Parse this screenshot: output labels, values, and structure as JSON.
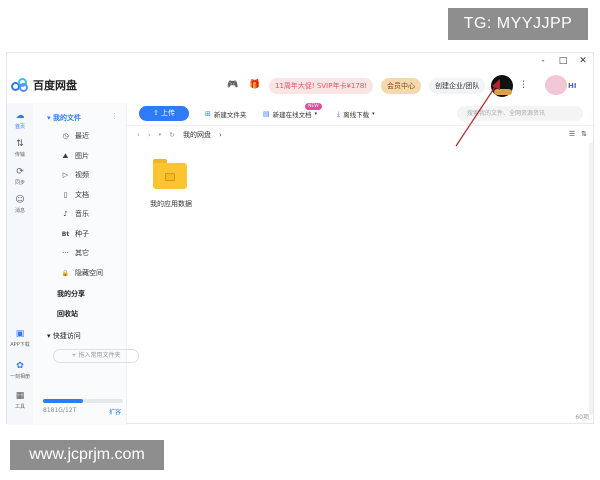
{
  "watermarks": {
    "top": "TG: MYYJJPP",
    "bottom": "www.jcprjm.com"
  },
  "window": {
    "controls": [
      "-",
      "□",
      "✕"
    ]
  },
  "app": {
    "title": "百度网盘"
  },
  "header": {
    "promo": "11周年大促! SVIP年卡¥178!",
    "vip_center": "会员中心",
    "create_business": "创建企业/团队",
    "more": "⋮",
    "mascot_greeting": "HI"
  },
  "rail": {
    "items": [
      {
        "label": "首页",
        "icon": "☁"
      },
      {
        "label": "传输",
        "icon": "⇅"
      },
      {
        "label": "同步",
        "icon": "⟳"
      },
      {
        "label": "消息",
        "icon": "☺"
      },
      {
        "label": "APP下载",
        "icon": "▣"
      },
      {
        "label": "一刻相册",
        "icon": "✿"
      },
      {
        "label": "工具",
        "icon": "▦"
      }
    ]
  },
  "sidebar": {
    "my_files": "我的文件",
    "items": [
      {
        "label": "最近",
        "icon": "◷"
      },
      {
        "label": "图片",
        "icon": "⛰"
      },
      {
        "label": "视频",
        "icon": "▷"
      },
      {
        "label": "文档",
        "icon": "▯"
      },
      {
        "label": "音乐",
        "icon": "♪"
      },
      {
        "label": "种子",
        "icon": "Bt"
      },
      {
        "label": "其它",
        "icon": "···"
      },
      {
        "label": "隐藏空间",
        "icon": "🔒"
      }
    ],
    "my_share": "我的分享",
    "recycle_bin": "回收站",
    "quick_access": "快捷访问",
    "add_quick": "+ 拖入常用文件夹",
    "quota": "8181G/12T",
    "quota_fraction": 0.5,
    "expand": "扩容"
  },
  "toolbar": {
    "upload": "上传",
    "new_folder": "新建文件夹",
    "new_online_doc": "新建在线文档",
    "new_badge": "NEW",
    "offline_download": "离线下载",
    "search_placeholder": "搜索我的文件、全网资源资讯"
  },
  "nav": {
    "breadcrumb": "我的网盘"
  },
  "files": [
    {
      "name": "我的应用数据"
    }
  ],
  "status": {
    "count": "60项"
  }
}
